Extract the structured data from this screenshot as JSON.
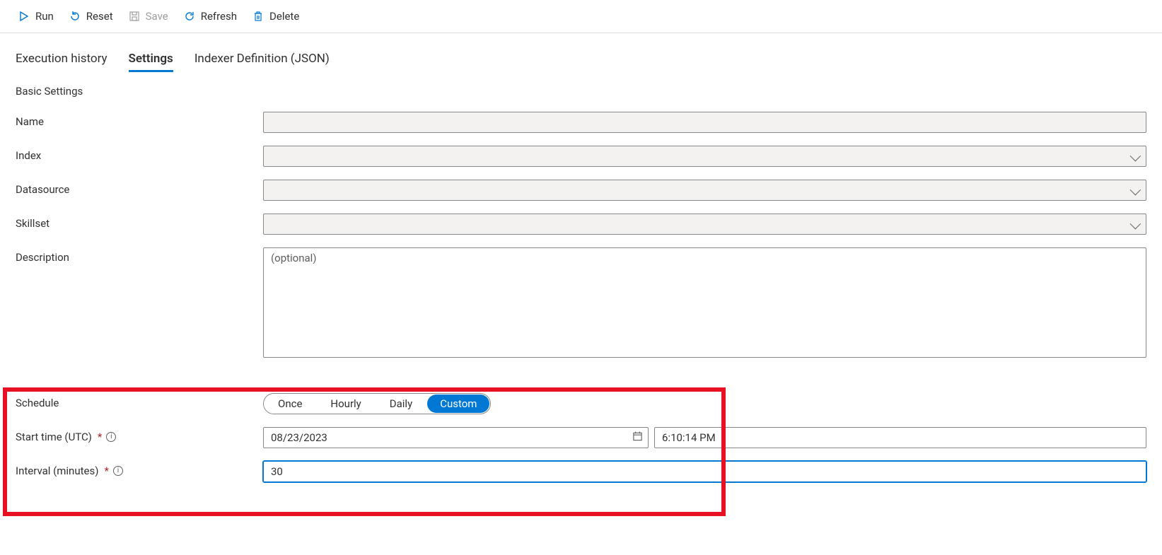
{
  "toolbar": {
    "run": "Run",
    "reset": "Reset",
    "save": "Save",
    "refresh": "Refresh",
    "delete": "Delete"
  },
  "tabs": {
    "history": "Execution history",
    "settings": "Settings",
    "json": "Indexer Definition (JSON)"
  },
  "section": {
    "basic": "Basic Settings"
  },
  "labels": {
    "name": "Name",
    "index": "Index",
    "datasource": "Datasource",
    "skillset": "Skillset",
    "description": "Description",
    "schedule": "Schedule",
    "start_time": "Start time (UTC)",
    "interval": "Interval (minutes)"
  },
  "fields": {
    "description_placeholder": "(optional)",
    "date_value": "08/23/2023",
    "time_value": "6:10:14 PM",
    "interval_value": "30"
  },
  "schedule_options": {
    "once": "Once",
    "hourly": "Hourly",
    "daily": "Daily",
    "custom": "Custom"
  }
}
